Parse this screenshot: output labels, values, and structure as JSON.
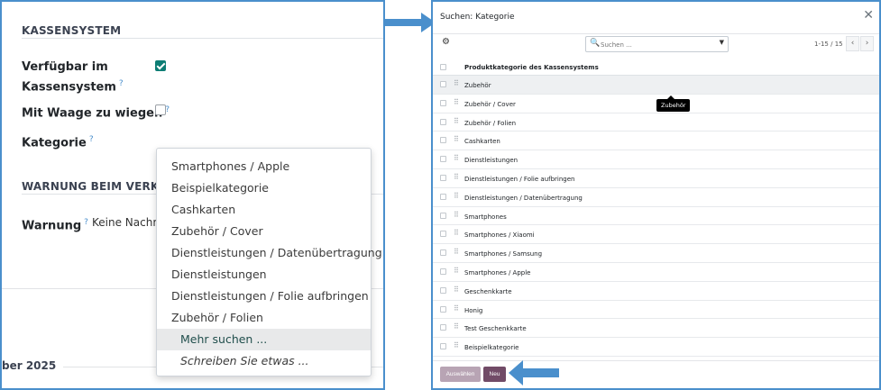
{
  "left": {
    "section1_title": "KASSENSYSTEM",
    "available_label_line1": "Verfügbar im",
    "available_label_line2": "Kassensystem",
    "help_mark": "?",
    "available_checked": true,
    "weigh_label": "Mit Waage zu wiegen",
    "weigh_checked": false,
    "category_label": "Kategorie",
    "section2_title": "WARNUNG BEIM VERKAUF",
    "warning_label": "Warnung",
    "warning_value": "Keine Nachricht",
    "date_fragment": "ber 2025",
    "dropdown_items": [
      "Smartphones / Apple",
      "Beispielkategorie",
      "Cashkarten",
      "Zubehör / Cover",
      "Dienstleistungen / Datenübertragung",
      "Dienstleistungen",
      "Dienstleistungen / Folie aufbringen",
      "Zubehör / Folien"
    ],
    "dropdown_more": "Mehr suchen ...",
    "dropdown_create": "Schreiben Sie etwas ..."
  },
  "dialog": {
    "title": "Suchen: Kategorie",
    "close_icon": "close-icon",
    "gear_icon": "gear-icon",
    "search_placeholder": "Suchen ...",
    "pager": "1-15 / 15",
    "column_header": "Produktkategorie des Kassensystems",
    "rows": [
      "Zubehör",
      "Zubehör / Cover",
      "Zubehör / Folien",
      "Cashkarten",
      "Dienstleistungen",
      "Dienstleistungen / Folie aufbringen",
      "Dienstleistungen / Datenübertragung",
      "Smartphones",
      "Smartphones / Xiaomi",
      "Smartphones / Samsung",
      "Smartphones / Apple",
      "Geschenkkarte",
      "Honig",
      "Test Geschenkkarte",
      "Beispielkategorie"
    ],
    "tooltip": "Zubehör",
    "select_button": "Auswählen",
    "new_button": "Neu"
  },
  "colors": {
    "accent_border": "#4a8fcc",
    "checkbox_on": "#0d7d74",
    "primary_button": "#714b67"
  }
}
